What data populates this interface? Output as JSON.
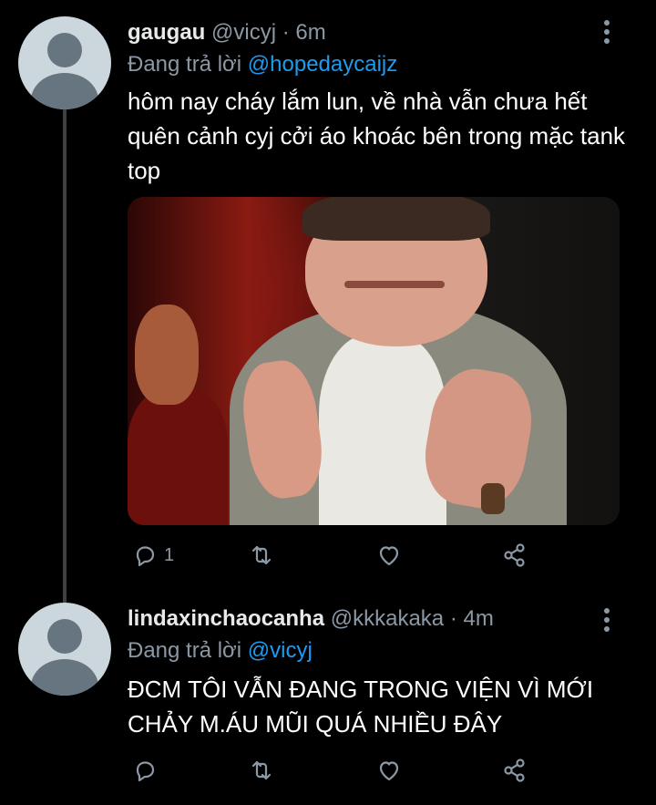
{
  "tweets": [
    {
      "name": "gaugau",
      "handle": "@vicyj",
      "separator": "·",
      "time": "6m",
      "reply_prefix": "Đang trả lời",
      "reply_to": "@hopedaycaijz",
      "text": "hôm nay cháy lắm lun, về nhà vẫn chưa hết quên cảnh cyj cởi áo khoác bên trong mặc tank top",
      "has_media": true,
      "reply_count": "1",
      "icons": {
        "reply": "reply-icon",
        "retweet": "retweet-icon",
        "like": "heart-icon",
        "share": "share-icon",
        "more": "more-vertical-icon"
      }
    },
    {
      "name": "lindaxinchaocanha",
      "handle": "@kkkakaka",
      "separator": "·",
      "time": "4m",
      "reply_prefix": "Đang trả lời",
      "reply_to": "@vicyj",
      "text": "ĐCM TÔI VẪN ĐANG TRONG VIỆN VÌ MỚI CHẢY M.ÁU MŨI QUÁ NHIỀU ĐÂY",
      "has_media": false,
      "reply_count": "",
      "icons": {
        "reply": "reply-icon",
        "retweet": "retweet-icon",
        "like": "heart-icon",
        "share": "share-icon",
        "more": "more-vertical-icon"
      }
    }
  ],
  "colors": {
    "background": "#000000",
    "text": "#e7e9ea",
    "secondary": "#8b98a5",
    "accent": "#1d9bf0",
    "thread_line": "#3d4144",
    "avatar_bg": "#ccd6dd",
    "avatar_fg": "#66757f"
  }
}
